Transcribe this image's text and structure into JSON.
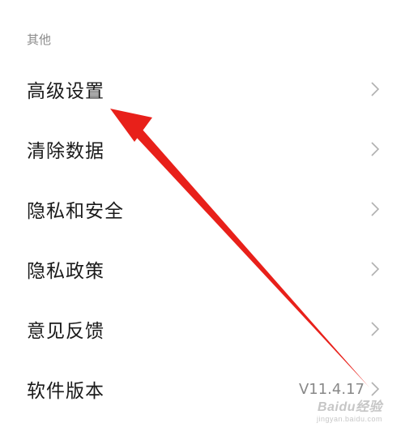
{
  "section": {
    "title": "其他"
  },
  "menu": {
    "items": [
      {
        "label": "高级设置",
        "value": ""
      },
      {
        "label": "清除数据",
        "value": ""
      },
      {
        "label": "隐私和安全",
        "value": ""
      },
      {
        "label": "隐私政策",
        "value": ""
      },
      {
        "label": "意见反馈",
        "value": ""
      },
      {
        "label": "软件版本",
        "value": "V11.4.17"
      }
    ]
  },
  "icons": {
    "chevron": "chevron-right-icon",
    "annotation": "red-arrow"
  },
  "colors": {
    "text_primary": "#1a1a1a",
    "text_secondary": "#8a8a8a",
    "chevron": "#b0b0b0",
    "annotation_arrow": "#e8201a"
  },
  "watermark": {
    "main": "Baidu经验",
    "sub": "jingyan.baidu.com"
  }
}
